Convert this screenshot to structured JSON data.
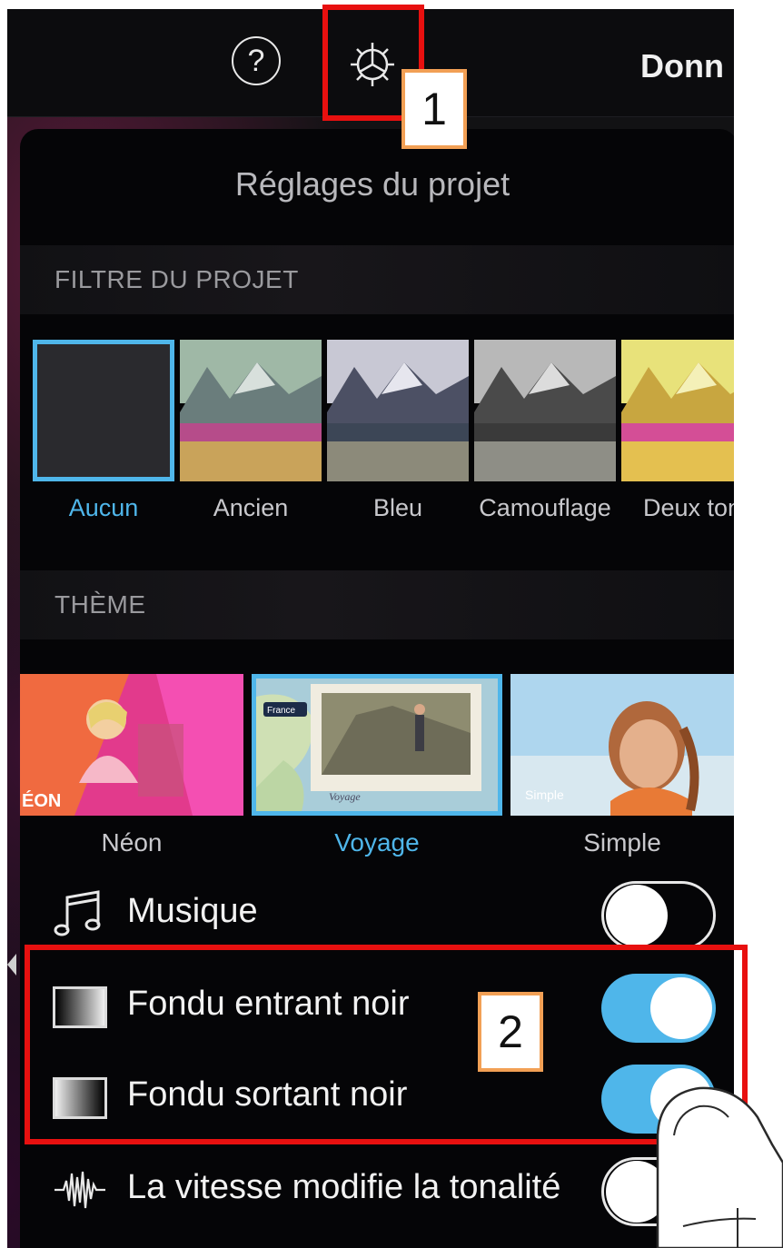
{
  "topbar": {
    "help_label": "?",
    "done_label": "Donn"
  },
  "panel": {
    "title": "Réglages du projet"
  },
  "filter_section": {
    "header": "FILTRE DU PROJET",
    "items": [
      {
        "label": "Aucun",
        "selected": true
      },
      {
        "label": "Ancien",
        "selected": false
      },
      {
        "label": "Bleu",
        "selected": false
      },
      {
        "label": "Camouflage",
        "selected": false
      },
      {
        "label": "Deux ton",
        "selected": false
      }
    ]
  },
  "theme_section": {
    "header": "THÈME",
    "items": [
      {
        "label": "Néon",
        "caption": "ÉON",
        "selected": false
      },
      {
        "label": "Voyage",
        "caption": "Voyage",
        "tag": "France",
        "selected": true
      },
      {
        "label": "Simple",
        "caption": "Simple",
        "selected": false
      }
    ]
  },
  "settings": {
    "music": {
      "label": "Musique",
      "on": false
    },
    "fade_in": {
      "label": "Fondu entrant noir",
      "on": true
    },
    "fade_out": {
      "label": "Fondu sortant noir",
      "on": true
    },
    "pitch": {
      "label": "La vitesse modifie la tonalité",
      "on": false
    }
  },
  "annotations": {
    "callout_1": "1",
    "callout_2": "2"
  },
  "colors": {
    "accent": "#4fb6ea",
    "highlight": "#e8100f",
    "callout_border": "#f2a055"
  },
  "icons": [
    "help-circle-icon",
    "gear-icon",
    "music-note-icon",
    "gradient-fade-in-icon",
    "gradient-fade-out-icon",
    "waveform-icon",
    "hand-pointer-icon"
  ]
}
